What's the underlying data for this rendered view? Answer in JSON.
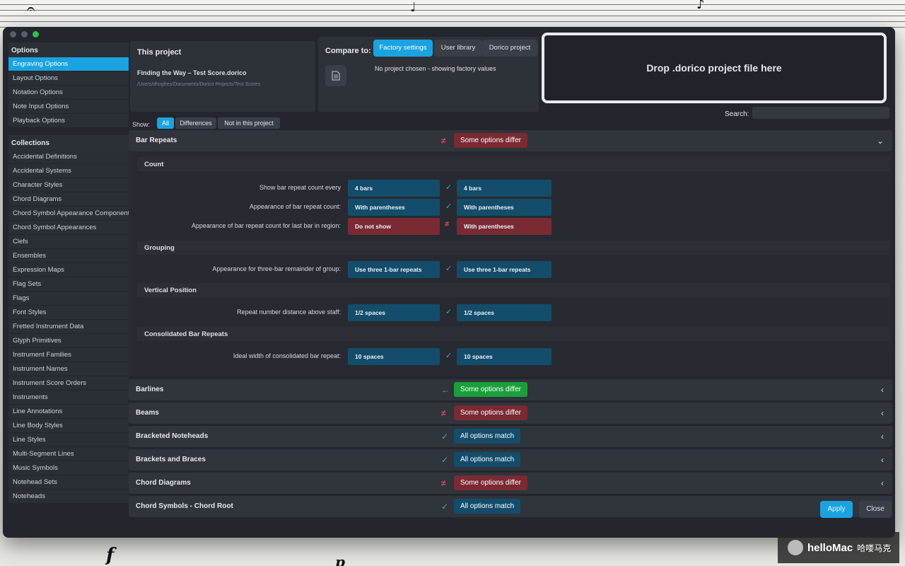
{
  "sidebar": {
    "options_header": "Options",
    "options": [
      "Engraving Options",
      "Layout Options",
      "Notation Options",
      "Note Input Options",
      "Playback Options"
    ],
    "collections_header": "Collections",
    "collections": [
      "Accidental Definitions",
      "Accidental Systems",
      "Character Styles",
      "Chord Diagrams",
      "Chord Symbol Appearance Components",
      "Chord Symbol Appearances",
      "Clefs",
      "Ensembles",
      "Expression Maps",
      "Flag Sets",
      "Flags",
      "Font Styles",
      "Fretted Instrument Data",
      "Glyph Primitives",
      "Instrument Families",
      "Instrument Names",
      "Instrument Score Orders",
      "Instruments",
      "Line Annotations",
      "Line Body Styles",
      "Line Styles",
      "Multi-Segment Lines",
      "Music Symbols",
      "Notehead Sets",
      "Noteheads"
    ]
  },
  "project": {
    "title": "This project",
    "file": "Finding the Way – Test Score.dorico",
    "path": "/Users/dhughes/Documents/Dorico Projects/Test Scores"
  },
  "compare": {
    "label": "Compare to:",
    "tabs": [
      "Factory settings",
      "User library",
      "Dorico project"
    ],
    "status": "No project chosen - showing factory values"
  },
  "drop_text": "Drop .dorico project file here",
  "search": {
    "label": "Search:",
    "value": ""
  },
  "show": {
    "label": "Show:",
    "options": [
      "All",
      "Differences",
      "Not in this project"
    ]
  },
  "sections": [
    {
      "title": "Bar Repeats",
      "status": "Some options differ",
      "state": "differ-red"
    },
    {
      "title": "Barlines",
      "status": "Some options differ",
      "state": "differ-green"
    },
    {
      "title": "Beams",
      "status": "Some options differ",
      "state": "differ-red"
    },
    {
      "title": "Bracketed Noteheads",
      "status": "All options match",
      "state": "match"
    },
    {
      "title": "Brackets and Braces",
      "status": "All options match",
      "state": "match"
    },
    {
      "title": "Chord Diagrams",
      "status": "Some options differ",
      "state": "differ-red"
    },
    {
      "title": "Chord Symbols - Chord Root",
      "status": "All options match",
      "state": "match"
    }
  ],
  "bar_repeats": {
    "groups": [
      {
        "title": "Count",
        "rows": [
          {
            "label": "Show bar repeat count every",
            "left": "4 bars",
            "right": "4 bars",
            "match": true
          },
          {
            "label": "Appearance of bar repeat count:",
            "left": "With parentheses",
            "right": "With parentheses",
            "match": true
          },
          {
            "label": "Appearance of bar repeat count for last bar in region:",
            "left": "Do not show",
            "right": "With parentheses",
            "match": false
          }
        ]
      },
      {
        "title": "Grouping",
        "rows": [
          {
            "label": "Appearance for three-bar remainder of group:",
            "left": "Use three 1-bar repeats",
            "right": "Use three 1-bar repeats",
            "match": true
          }
        ]
      },
      {
        "title": "Vertical Position",
        "rows": [
          {
            "label": "Repeat number distance above staff:",
            "left": "1/2 spaces",
            "right": "1/2 spaces",
            "match": true
          }
        ]
      },
      {
        "title": "Consolidated Bar Repeats",
        "rows": [
          {
            "label": "Ideal width of consolidated bar repeat:",
            "left": "10 spaces",
            "right": "10 spaces",
            "match": true
          }
        ]
      }
    ]
  },
  "footer": {
    "apply": "Apply",
    "close": "Close"
  },
  "watermark": {
    "brand": "helloMac",
    "cn": "哈喽马克"
  },
  "score_marks": {
    "dynamic_left": "f",
    "dynamic_right": "p"
  },
  "colors": {
    "accent": "#1aa3e0",
    "differ": "#7a2a33",
    "differ_green": "#1b9f3a",
    "match": "#134d6b"
  }
}
